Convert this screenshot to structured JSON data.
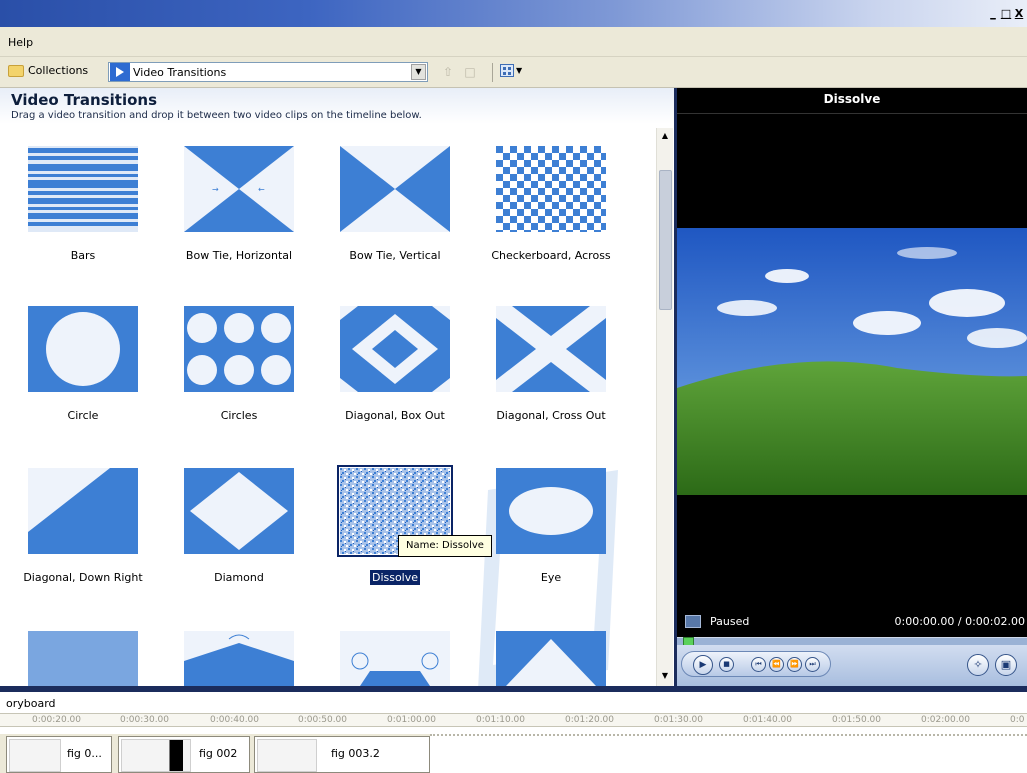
{
  "window": {
    "controls": [
      "_",
      "̈",
      "X"
    ]
  },
  "menubar": {
    "items": [
      "Help"
    ]
  },
  "toolbar": {
    "collections_label": "Collections",
    "collection_select": "Video Transitions"
  },
  "pane": {
    "title": "Video Transitions",
    "subtitle": "Drag a video transition and drop it between two video clips on the timeline below."
  },
  "transitions": [
    {
      "label": "Bars",
      "icon": "bars-transition-icon"
    },
    {
      "label": "Bow Tie, Horizontal",
      "icon": "bow-tie-horizontal-icon"
    },
    {
      "label": "Bow Tie, Vertical",
      "icon": "bow-tie-vertical-icon"
    },
    {
      "label": "Checkerboard, Across",
      "icon": "checkerboard-icon"
    },
    {
      "label": "Circle",
      "icon": "circle-icon"
    },
    {
      "label": "Circles",
      "icon": "circles-icon"
    },
    {
      "label": "Diagonal, Box Out",
      "icon": "diagonal-box-out-icon"
    },
    {
      "label": "Diagonal, Cross Out",
      "icon": "diagonal-cross-out-icon"
    },
    {
      "label": "Diagonal, Down Right",
      "icon": "diagonal-down-right-icon"
    },
    {
      "label": "Diamond",
      "icon": "diamond-icon"
    },
    {
      "label": "Dissolve",
      "icon": "dissolve-icon",
      "selected": true
    },
    {
      "label": "Eye",
      "icon": "eye-icon"
    }
  ],
  "tooltip": "Name: Dissolve",
  "preview": {
    "title": "Dissolve",
    "status": "Paused",
    "time": "0:00:00.00 / 0:00:02.00"
  },
  "storyboard": {
    "label": "oryboard",
    "ticks": [
      "0:00:20.00",
      "0:00:30.00",
      "0:00:40.00",
      "0:00:50.00",
      "0:01:00.00",
      "0:01:10.00",
      "0:01:20.00",
      "0:01:30.00",
      "0:01:40.00",
      "0:01:50.00",
      "0:02:00.00",
      "0:0"
    ],
    "clips": [
      "fig 0...",
      "fig 002",
      "fig 003.2"
    ]
  },
  "colors": {
    "transition_blue": "#3d7fd4",
    "selection": "#0a2466",
    "tooltip_bg": "#ffffe1"
  }
}
